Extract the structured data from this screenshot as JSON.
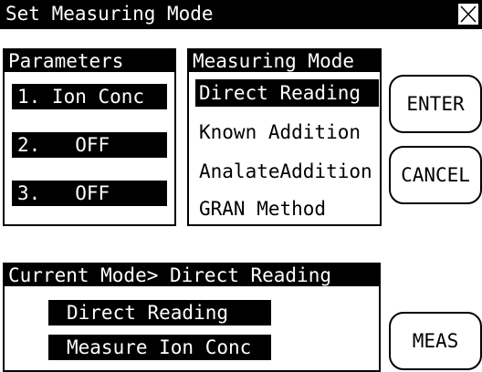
{
  "titlebar": {
    "title": "Set Measuring Mode",
    "close_icon": "close-icon"
  },
  "parameters": {
    "header": "Parameters",
    "items": [
      "1. Ion Conc",
      "2.   OFF",
      "3.   OFF"
    ]
  },
  "measuring_mode": {
    "header": "Measuring Mode",
    "options": [
      "Direct Reading",
      "Known Addition",
      "AnalateAddition",
      "GRAN Method"
    ],
    "selected_index": 0
  },
  "buttons": {
    "enter": "ENTER",
    "cancel": "CANCEL",
    "meas": "MEAS"
  },
  "current_mode": {
    "header": "Current Mode> Direct Reading",
    "line1": "Direct Reading",
    "line2": "Measure Ion Conc"
  }
}
